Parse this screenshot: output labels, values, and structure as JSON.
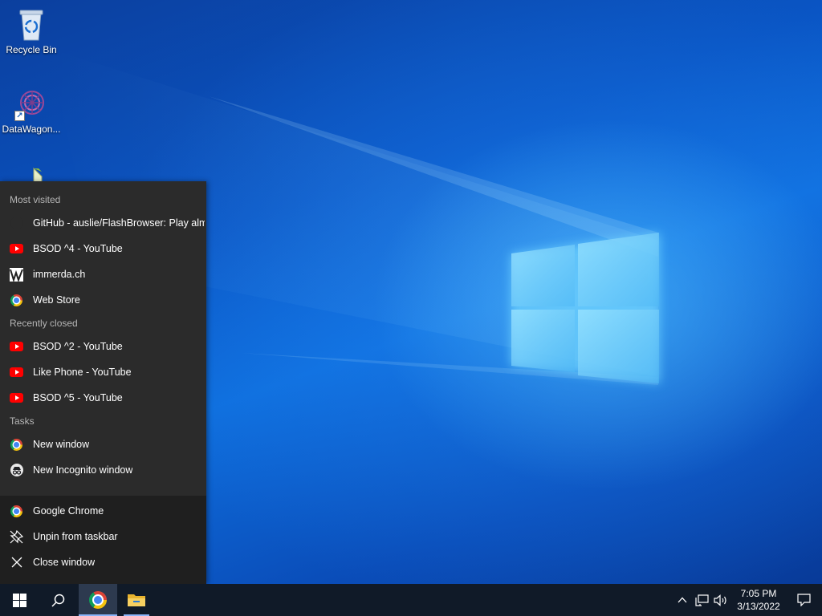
{
  "desktop": {
    "icons": [
      {
        "label": "Recycle Bin",
        "icon": "recycle-bin-icon"
      },
      {
        "label": "DataWagon...",
        "icon": "datawagon-icon"
      },
      {
        "label": "",
        "icon": "file-icon"
      }
    ]
  },
  "jumplist": {
    "most_visited_header": "Most visited",
    "most_visited": [
      {
        "label": "GitHub - auslie/FlashBrowser: Play alm...",
        "icon": "github-icon"
      },
      {
        "label": "BSOD ^4 - YouTube",
        "icon": "youtube-icon"
      },
      {
        "label": "immerda.ch",
        "icon": "immerda-icon"
      },
      {
        "label": "Web Store",
        "icon": "chrome-icon"
      }
    ],
    "recently_closed_header": "Recently closed",
    "recently_closed": [
      {
        "label": "BSOD ^2 - YouTube",
        "icon": "youtube-icon"
      },
      {
        "label": "Like Phone - YouTube",
        "icon": "youtube-icon"
      },
      {
        "label": "BSOD ^5 - YouTube",
        "icon": "youtube-icon"
      }
    ],
    "tasks_header": "Tasks",
    "tasks": [
      {
        "label": "New window",
        "icon": "chrome-icon"
      },
      {
        "label": "New Incognito window",
        "icon": "incognito-icon"
      }
    ],
    "actions": [
      {
        "label": "Google Chrome",
        "icon": "chrome-icon"
      },
      {
        "label": "Unpin from taskbar",
        "icon": "unpin-icon"
      },
      {
        "label": "Close window",
        "icon": "close-icon"
      }
    ]
  },
  "taskbar": {
    "clock_time": "7:05 PM",
    "clock_date": "3/13/2022"
  },
  "colors": {
    "jumplist_bg": "#2b2b2b",
    "jumplist_bottom_bg": "#1f1f1f",
    "taskbar_bg": "#101a28",
    "youtube_red": "#ff0000"
  }
}
